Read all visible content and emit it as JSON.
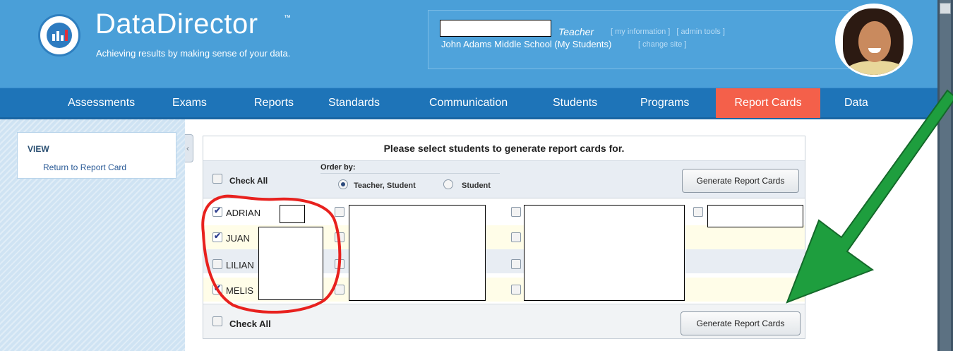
{
  "header": {
    "brand": "DataDirector",
    "trademark": "™",
    "tagline": "Achieving results by making sense of your data.",
    "user_role": "Teacher",
    "user_links": [
      "[ my information ]",
      "[ admin tools ]"
    ],
    "school": "John Adams Middle School (My Students)",
    "change_site": "[ change site ]"
  },
  "nav": {
    "items": [
      "Assessments",
      "Exams",
      "Reports",
      "Standards",
      "Communication",
      "Students",
      "Programs",
      "Report Cards",
      "Data"
    ],
    "active": "Report Cards"
  },
  "sidebar": {
    "view_title": "VIEW",
    "view_link": "Return to Report Card"
  },
  "form": {
    "title": "Please select students to generate report cards for.",
    "check_all": "Check All",
    "order_by": "Order by:",
    "order_options": [
      "Teacher, Student",
      "Student"
    ],
    "order_selected": "Teacher, Student",
    "generate_button": "Generate Report Cards",
    "students": [
      {
        "name": "ADRIAN",
        "checked": true
      },
      {
        "name": "JUAN",
        "checked": true
      },
      {
        "name": "LILIAN",
        "checked": false
      },
      {
        "name": "MELIS",
        "checked": true
      }
    ]
  },
  "colors": {
    "header_bg": "#4a9fd8",
    "nav_bg": "#1e74b8",
    "nav_active": "#f4604a",
    "annotation_circle": "#e8211e",
    "annotation_arrow": "#1e9e3e"
  },
  "icons": [
    "logo-icon",
    "checkbox-icon",
    "radio-icon",
    "collapse-arrow-icon",
    "scroll-up-icon"
  ]
}
